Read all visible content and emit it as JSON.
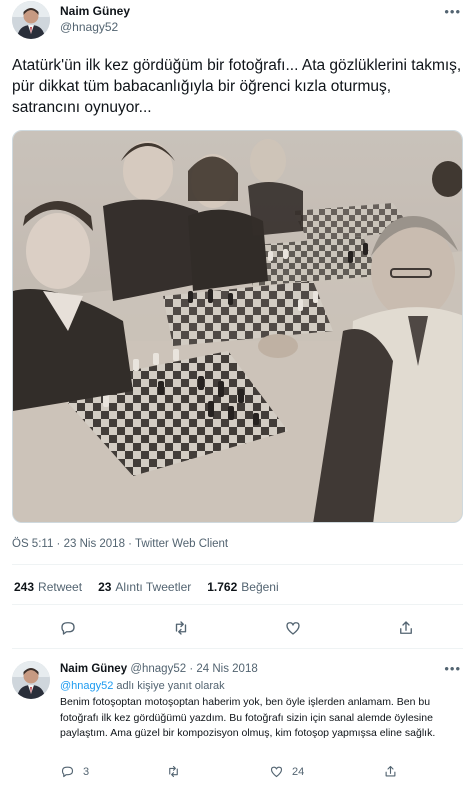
{
  "tweet": {
    "author_name": "Naim Güney",
    "author_handle": "@hnagy52",
    "text": "Atatürk'ün ilk kez gördüğüm bir fotoğrafı... Ata gözlüklerini takmış, pür dikkat tüm babacanlığıyla  bir öğrenci kızla  oturmuş, satrancını oynuyor...",
    "time": "ÖS 5:11",
    "date": "23 Nis 2018",
    "separator": "·",
    "client": "Twitter Web Client",
    "more_icon": "more-icon"
  },
  "stats": {
    "retweets_count": "243",
    "retweets_label": "Retweet",
    "quotes_count": "23",
    "quotes_label": "Alıntı Tweetler",
    "likes_count": "1.762",
    "likes_label": "Beğeni"
  },
  "actions": [
    "reply-icon",
    "retweet-icon",
    "like-icon",
    "share-icon"
  ],
  "reply": {
    "author_name": "Naim Güney",
    "author_handle": "@hnagy52",
    "date": "24 Nis 2018",
    "separator": "·",
    "reply_to_handle": "@hnagy52",
    "reply_to_suffix": " adlı kişiye yanıt olarak",
    "text": "Benim fotoşoptan motoşoptan haberim yok, ben öyle işlerden anlamam. Ben bu fotoğrafı ilk kez gördüğümü yazdım. Bu fotoğrafı sizin için sanal alemde öylesine paylaştım. Ama güzel bir kompozisyon olmuş, kim fotoşop yapmışsa eline sağlık.",
    "reply_count": "3",
    "like_count": "24"
  },
  "colors": {
    "text_primary": "#0f1419",
    "text_secondary": "#536471",
    "link": "#1d9bf0",
    "divider": "#eff3f4"
  }
}
